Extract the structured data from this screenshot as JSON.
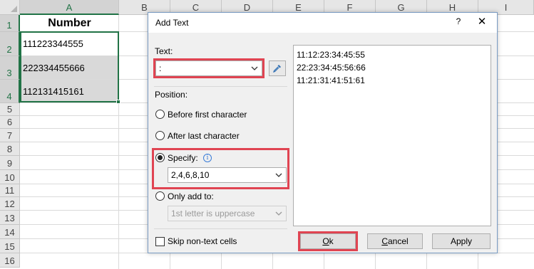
{
  "sheet": {
    "columns": [
      "A",
      "B",
      "C",
      "D",
      "E",
      "F",
      "G",
      "H",
      "I"
    ],
    "selected_column": "A",
    "rows": [
      "1",
      "2",
      "3",
      "4",
      "5",
      "6",
      "7",
      "8",
      "9",
      "10",
      "11",
      "12",
      "13",
      "14",
      "15",
      "16"
    ],
    "selected_rows": [
      "1",
      "2",
      "3",
      "4"
    ],
    "cells": {
      "A1": "Number",
      "A2": "111223344555",
      "A3": "222334455666",
      "A4": "112131415161"
    },
    "selection_color": "#217346"
  },
  "dialog": {
    "title": "Add Text",
    "help_symbol": "?",
    "close_symbol": "✕",
    "text_label": "Text:",
    "text_value": ":",
    "position_label": "Position:",
    "options": [
      {
        "label": "Before first character",
        "selected": false
      },
      {
        "label": "After last character",
        "selected": false
      },
      {
        "label": "Specify:",
        "selected": true
      },
      {
        "label": "Only add to:",
        "selected": false
      }
    ],
    "info_symbol": "i",
    "specify_value": "2,4,6,8,10",
    "only_add_value": "1st letter is uppercase",
    "preview_lines": [
      "11:12:23:34:45:55",
      "22:23:34:45:56:66",
      "11:21:31:41:51:61"
    ],
    "skip_label": "Skip non-text cells",
    "skip_checked": false,
    "buttons": {
      "ok": {
        "mnemonic": "O",
        "rest": "k"
      },
      "cancel": {
        "mnemonic": "C",
        "rest": "ancel"
      },
      "apply": "Apply"
    },
    "highlight_color": "#e04452"
  }
}
